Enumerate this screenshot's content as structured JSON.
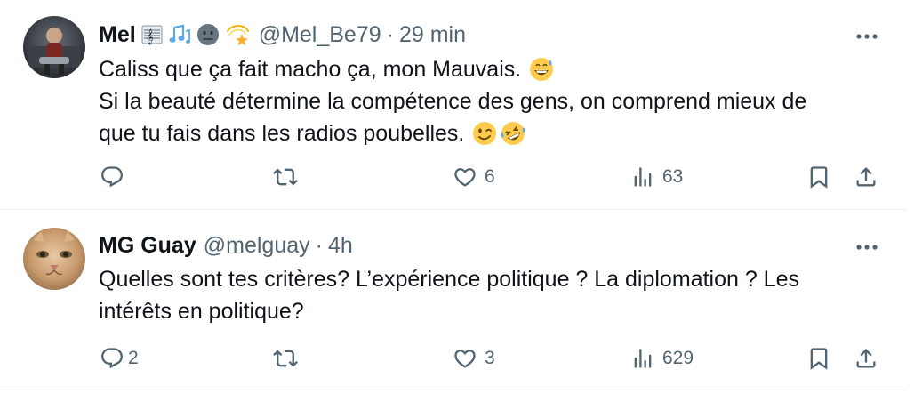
{
  "colors": {
    "text": "#0f1419",
    "secondary": "#536471",
    "divider": "#eff3f4"
  },
  "tweets": [
    {
      "display_name": "Mel",
      "name_emojis": [
        "musical-score-icon",
        "musical-notes-icon",
        "neutral-face-icon",
        "dizzy-star-icon"
      ],
      "handle": "@Mel_Be79",
      "separator": "·",
      "time": "29 min",
      "lines": [
        {
          "text": "Caliss que ça fait macho ça, mon Mauvais.",
          "emojis": [
            "grinning-sweat-icon"
          ]
        },
        {
          "text": "Si la beauté détermine la compétence des gens, on comprend mieux de",
          "emojis": []
        },
        {
          "text": "que tu fais dans les radios poubelles.",
          "emojis": [
            "winking-face-icon",
            "rolling-laughing-icon"
          ]
        }
      ],
      "replies": "",
      "retweets": "",
      "likes": "6",
      "views": "63"
    },
    {
      "display_name": "MG Guay",
      "name_emojis": [],
      "handle": "@melguay",
      "separator": "·",
      "time": "4h",
      "lines": [
        {
          "text": "Quelles sont tes critères? L’expérience politique ? La diplomation ? Les",
          "emojis": []
        },
        {
          "text": "intérêts en politique?",
          "emojis": []
        }
      ],
      "replies": "2",
      "retweets": "",
      "likes": "3",
      "views": "629"
    }
  ]
}
